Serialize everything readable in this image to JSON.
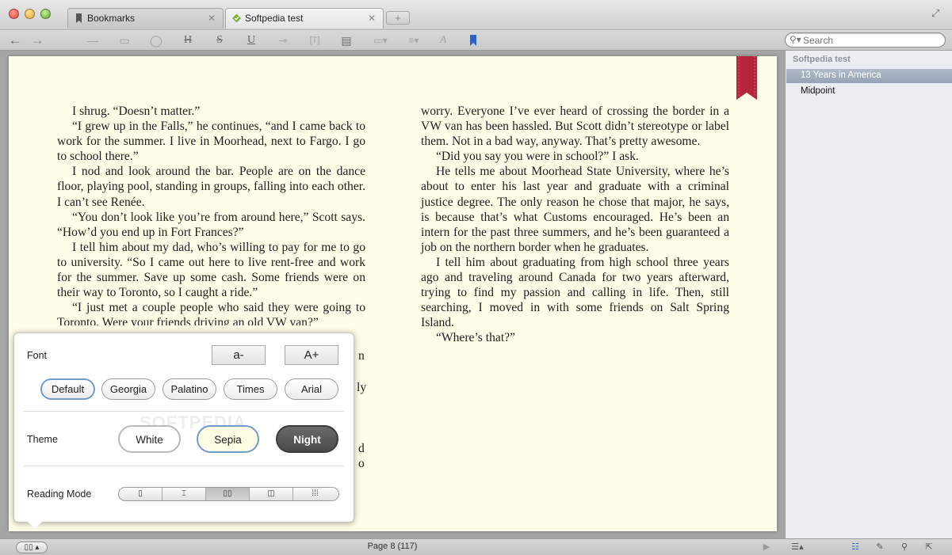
{
  "tabs": [
    {
      "label": "Bookmarks",
      "icon": "bookmark-icon"
    },
    {
      "label": "Softpedia test",
      "icon": "softpedia-icon"
    }
  ],
  "toolbar": {
    "back": "←",
    "forward": "→",
    "search_placeholder": "Search"
  },
  "book": {
    "left_column": [
      {
        "text": "I shrug. “Doesn’t matter.”",
        "indent": true
      },
      {
        "text": "“I grew up in the Falls,” he continues, “and I came back to work for the summer. I live in Moorhead, next to Fargo. I go to school there.”",
        "indent": true
      },
      {
        "text": "I nod and look around the bar. People are on the dance floor, playing pool, standing in groups, falling into each other. I can’t see Renée.",
        "indent": true
      },
      {
        "text": "“You don’t look like you’re from around here,” Scott says. “How’d you end up in Fort Frances?”",
        "indent": true
      },
      {
        "text": "I tell him about my dad, who’s willing to pay for me to go to university. “So I came out here to live rent-free and work for the summer. Save up some cash. Some friends were on their way to Toronto, so I caught a ride.”",
        "indent": true
      },
      {
        "text": "“I just met a couple people who said they were going to Toronto. Were your friends driving an old VW van?”",
        "indent": true
      }
    ],
    "left_peek": [
      "n",
      "ly",
      "d",
      "o"
    ],
    "right_column": [
      {
        "text": "worry. Everyone I’ve ever heard of crossing the border in a VW van has been hassled. But Scott didn’t stereotype or label them. Not in a bad way, anyway. That’s pretty awesome.",
        "indent": false
      },
      {
        "text": "“Did you say you were in school?” I ask.",
        "indent": true
      },
      {
        "text": "He tells me about Moorhead State University, where he’s about to enter his last year and graduate with a criminal justice degree. The only reason he chose that major, he says, is because that’s what Customs encouraged. He’s been an intern for the past three summers, and he’s been guaranteed a job on the northern border when he graduates.",
        "indent": true
      },
      {
        "text": "I tell him about graduating from high school three years ago and traveling around Canada for two years afterward, trying to find my passion and calling in life. Then, still searching, I moved in with some friends on Salt Spring Island.",
        "indent": true
      },
      {
        "text": "“Where’s that?”",
        "indent": true
      }
    ]
  },
  "sidebar": {
    "heading": "Softpedia test",
    "items": [
      {
        "label": "13 Years in America",
        "selected": true
      },
      {
        "label": "Midpoint",
        "selected": false
      }
    ]
  },
  "status": {
    "page_label": "Page 8 (117)"
  },
  "popover": {
    "font_label": "Font",
    "decrease_label": "a-",
    "increase_label": "A+",
    "fonts": [
      "Default",
      "Georgia",
      "Palatino",
      "Times",
      "Arial"
    ],
    "selected_font": "Default",
    "theme_label": "Theme",
    "themes": [
      "White",
      "Sepia",
      "Night"
    ],
    "selected_theme": "Sepia",
    "reading_mode_label": "Reading Mode",
    "reading_modes": [
      "single-page-icon",
      "scroll-page-icon",
      "two-page-icon",
      "book-spread-icon",
      "grid-icon"
    ],
    "selected_reading_mode": "two-page-icon",
    "watermark": "SOFTPEDIA"
  },
  "colors": {
    "page_bg": "#fefde8",
    "selection_blue": "#6f9cc9",
    "ribbon_red": "#b5263b"
  }
}
